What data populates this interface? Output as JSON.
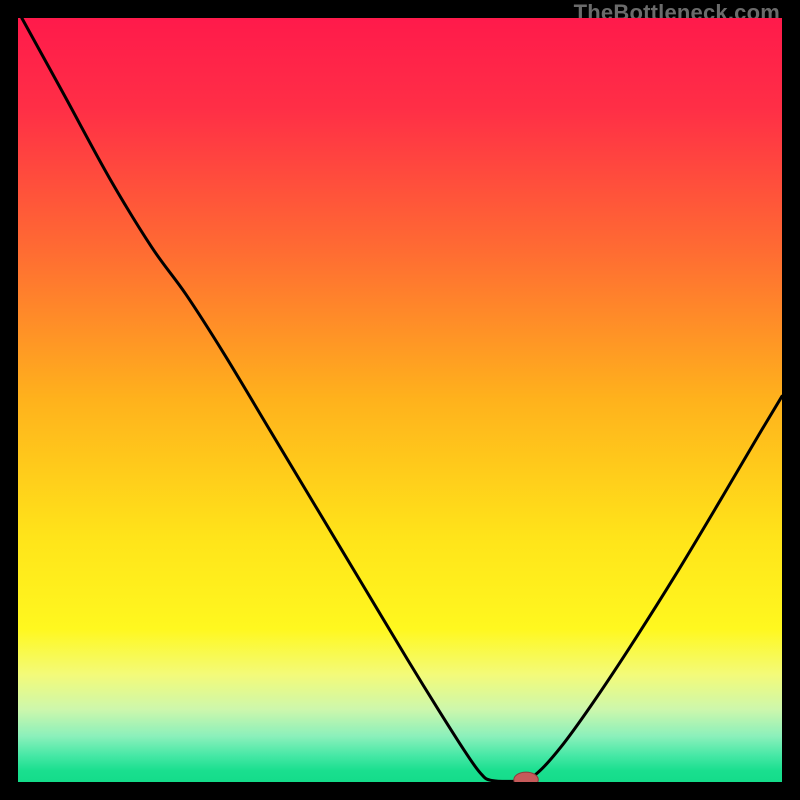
{
  "watermark": "TheBottleneck.com",
  "chart_data": {
    "type": "line",
    "title": "",
    "xlabel": "",
    "ylabel": "",
    "xlim": [
      0,
      100
    ],
    "ylim": [
      0,
      100
    ],
    "grid": false,
    "legend": false,
    "background_gradient_stops": [
      {
        "offset": 0.0,
        "color": "#ff1a4b"
      },
      {
        "offset": 0.12,
        "color": "#ff2f46"
      },
      {
        "offset": 0.3,
        "color": "#ff6a33"
      },
      {
        "offset": 0.5,
        "color": "#ffb21c"
      },
      {
        "offset": 0.68,
        "color": "#ffe41a"
      },
      {
        "offset": 0.8,
        "color": "#fff81f"
      },
      {
        "offset": 0.86,
        "color": "#f3fb7a"
      },
      {
        "offset": 0.905,
        "color": "#cdf7ac"
      },
      {
        "offset": 0.94,
        "color": "#8bf0bb"
      },
      {
        "offset": 0.965,
        "color": "#47e8a6"
      },
      {
        "offset": 0.985,
        "color": "#1adf8f"
      },
      {
        "offset": 1.0,
        "color": "#14dc8a"
      }
    ],
    "series": [
      {
        "name": "bottleneck-curve",
        "stroke": "#000000",
        "stroke_width": 3,
        "points": [
          {
            "x": 0.5,
            "y": 100.0
          },
          {
            "x": 6.0,
            "y": 90.0
          },
          {
            "x": 12.0,
            "y": 79.0
          },
          {
            "x": 17.5,
            "y": 70.0
          },
          {
            "x": 22.0,
            "y": 63.8
          },
          {
            "x": 27.0,
            "y": 56.0
          },
          {
            "x": 33.0,
            "y": 46.0
          },
          {
            "x": 39.0,
            "y": 36.0
          },
          {
            "x": 45.0,
            "y": 26.0
          },
          {
            "x": 51.0,
            "y": 16.0
          },
          {
            "x": 55.0,
            "y": 9.5
          },
          {
            "x": 58.5,
            "y": 4.0
          },
          {
            "x": 60.5,
            "y": 1.2
          },
          {
            "x": 62.0,
            "y": 0.2
          },
          {
            "x": 66.0,
            "y": 0.2
          },
          {
            "x": 68.0,
            "y": 1.2
          },
          {
            "x": 71.0,
            "y": 4.5
          },
          {
            "x": 75.0,
            "y": 10.0
          },
          {
            "x": 80.0,
            "y": 17.5
          },
          {
            "x": 86.0,
            "y": 27.0
          },
          {
            "x": 92.0,
            "y": 37.0
          },
          {
            "x": 97.0,
            "y": 45.5
          },
          {
            "x": 100.0,
            "y": 50.5
          }
        ]
      }
    ],
    "marker": {
      "name": "optimal-point",
      "x": 66.5,
      "y": 0.3,
      "rx": 1.6,
      "ry": 1.0,
      "fill": "#c65a5a",
      "stroke": "#8b3c3c"
    }
  }
}
